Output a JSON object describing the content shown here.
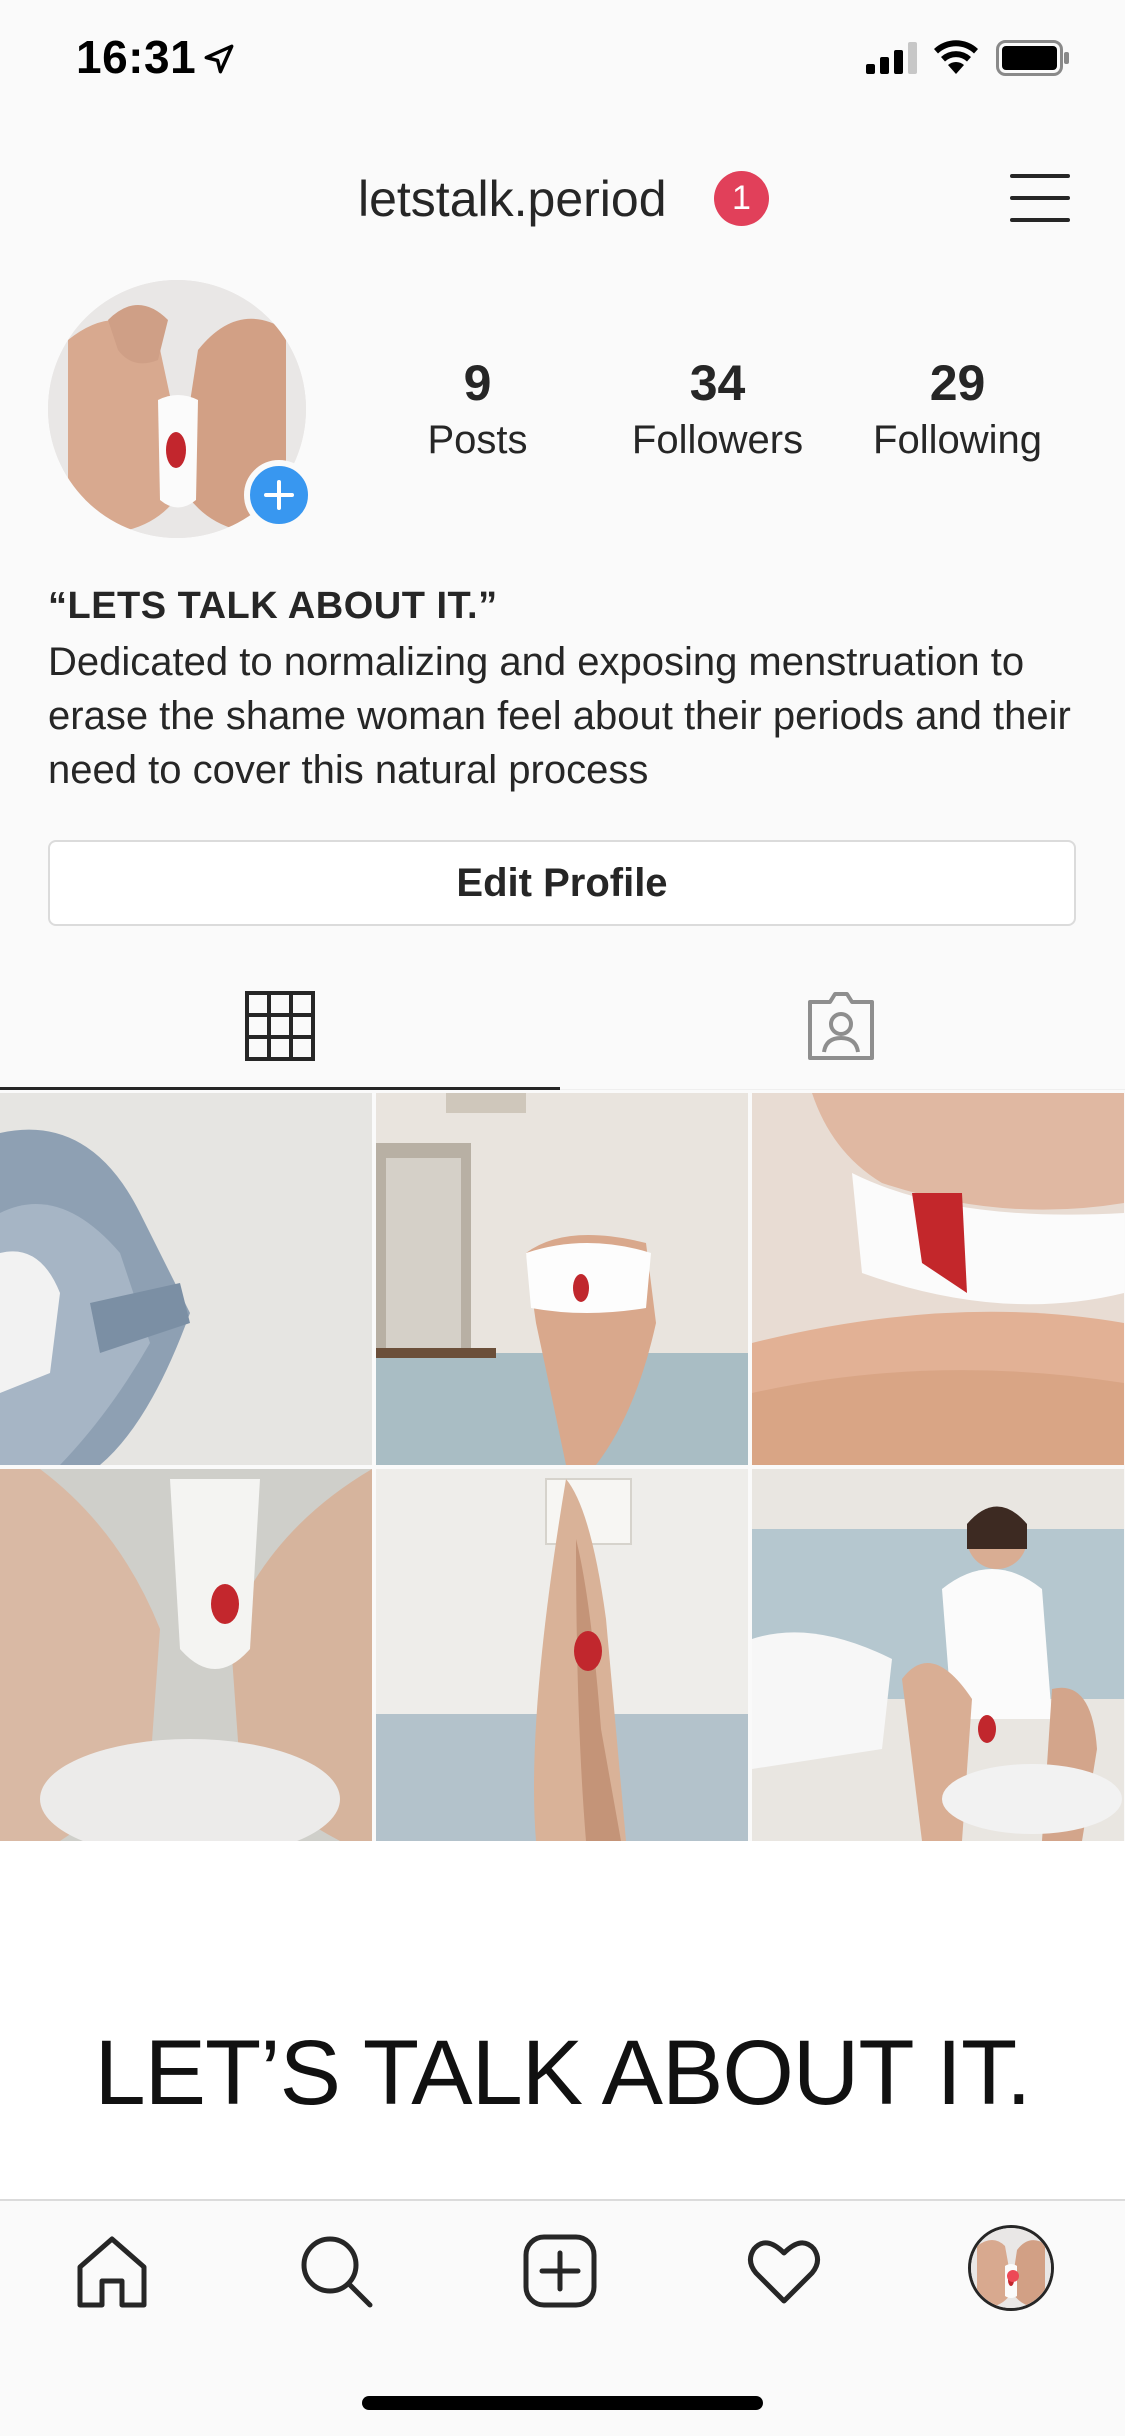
{
  "status_bar": {
    "time": "16:31",
    "icons": [
      "location-arrow-icon",
      "signal-icon",
      "wifi-icon",
      "battery-icon"
    ]
  },
  "header": {
    "username": "letstalk.period",
    "notification_count": "1",
    "menu_icon": "hamburger-menu-icon"
  },
  "profile": {
    "avatar_icon": "profile-photo",
    "add_story_icon": "plus-icon",
    "stats": [
      {
        "value": "9",
        "label": "Posts"
      },
      {
        "value": "34",
        "label": "Followers"
      },
      {
        "value": "29",
        "label": "Following"
      }
    ],
    "bio_title": "“LETS TALK ABOUT IT.”",
    "bio_text": "Dedicated to normalizing and exposing menstruation to erase the shame woman feel about their periods and their need to cover this natural process",
    "edit_button_label": "Edit Profile"
  },
  "tabs": [
    {
      "icon": "grid-icon",
      "active": true
    },
    {
      "icon": "tagged-person-icon",
      "active": false
    }
  ],
  "posts": [
    {
      "id": "post-1"
    },
    {
      "id": "post-2"
    },
    {
      "id": "post-3"
    },
    {
      "id": "post-4"
    },
    {
      "id": "post-5"
    },
    {
      "id": "post-6"
    }
  ],
  "banner": {
    "text": "LET’S TALK ABOUT IT."
  },
  "tab_bar": {
    "items": [
      "home-icon",
      "search-icon",
      "add-post-icon",
      "heart-icon",
      "profile-icon"
    ],
    "has_activity_dot": true
  },
  "colors": {
    "accent_blue": "#3897f0",
    "badge_red": "#e1405a",
    "text": "#262626",
    "border": "#dbdbdb"
  }
}
